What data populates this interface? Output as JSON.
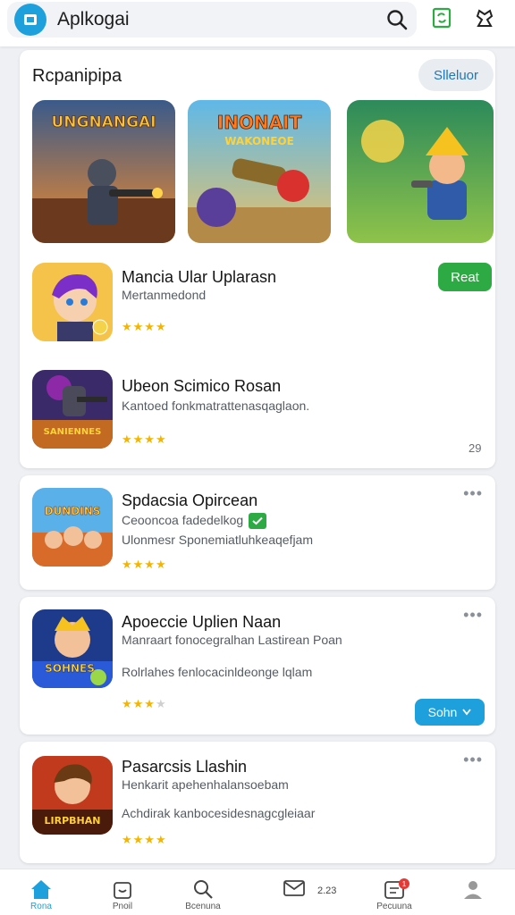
{
  "header": {
    "title": "Aplkogai",
    "icons": [
      "store-logo-icon",
      "search-icon",
      "refresh-icon",
      "profile-icon"
    ]
  },
  "featured": {
    "title": "Rcpanipipa",
    "chip_label": "Slleluor",
    "banners": [
      {
        "title": "UNGNANGAI",
        "subtitle": "",
        "icon": "shooter-game-art"
      },
      {
        "title": "INONAIT",
        "subtitle": "WAKONEOE",
        "icon": "blaster-game-art"
      },
      {
        "title": "",
        "subtitle": "",
        "icon": "cartoon-hero-game-art"
      }
    ],
    "apps": [
      {
        "name": "Mancia Ular Uplarasn",
        "sub": "Mertanmedond",
        "rating": 4,
        "button": "Reat"
      },
      {
        "name": "Ubeon Scimico Rosan",
        "sub": "Kantoed fonkmatrattenasqaglaon.",
        "rating": 4,
        "count": "29",
        "icon_title": "SANIENNES"
      }
    ]
  },
  "apps": [
    {
      "name": "Spdacsia Opircean",
      "line1": "Ceooncoa fadedelkog",
      "line2": "Ulonmesr Sponemiatluhkeaqefjam",
      "rating": 4,
      "icon_title": "DUNDINS"
    },
    {
      "name": "Apoeccie Uplien Naan",
      "line1": "Manraart fonocegralhan Lastirean Poan",
      "line2": "Rolrlahes fenlocacinldeonge lqlam",
      "rating": 3.5,
      "button": "Sohn",
      "icon_title": "SOHNES"
    },
    {
      "name": "Pasarcsis Llashin",
      "line1": "Henkarit apehenhalansoebam",
      "line2": "Achdirak kanbocesidesnagcgleiaar",
      "rating": 4,
      "icon_title": "LIRPBHAN"
    }
  ],
  "nav": {
    "items": [
      {
        "label": "Rona",
        "icon": "home-icon"
      },
      {
        "label": "Pnoil",
        "icon": "gift-icon"
      },
      {
        "label": "Bcenuna",
        "icon": "search-icon"
      },
      {
        "label": "",
        "icon": "mail-icon"
      },
      {
        "label": "Pecuuna",
        "icon": "news-icon"
      },
      {
        "label": "",
        "icon": "person-icon"
      }
    ],
    "count": "2.23",
    "badge": "1"
  },
  "colors": {
    "accent": "#1ea0dc",
    "green": "#2eaa44",
    "star": "#f4b400"
  }
}
